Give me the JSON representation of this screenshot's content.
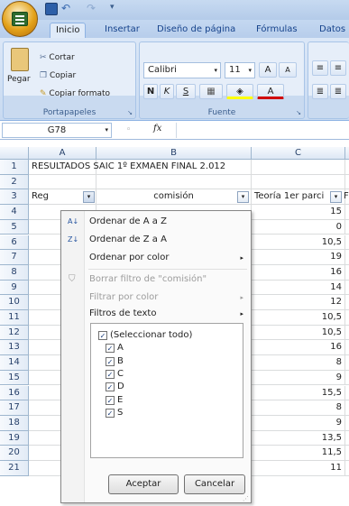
{
  "ribbon": {
    "tabs": [
      "Inicio",
      "Insertar",
      "Diseño de página",
      "Fórmulas",
      "Datos"
    ],
    "clipboard": {
      "paste": "Pegar",
      "cut": "Cortar",
      "copy": "Copiar",
      "format_painter": "Copiar formato",
      "label": "Portapapeles"
    },
    "font": {
      "name": "Calibri",
      "size": "11",
      "grow": "A",
      "shrink": "A",
      "bold": "N",
      "italic": "K",
      "underline": "S",
      "label": "Fuente"
    }
  },
  "formula_bar": {
    "name_box": "G78",
    "fx": "fx"
  },
  "sheet": {
    "columns": [
      "A",
      "B",
      "C"
    ],
    "rows": [
      {
        "n": "1",
        "a": "RESULTADOS SAIC 1º EXMAEN FINAL 2.012",
        "c": ""
      },
      {
        "n": "2",
        "a": "",
        "c": ""
      },
      {
        "n": "3",
        "a": "Reg",
        "b": "comisión",
        "c": "Teoría 1er parci"
      },
      {
        "n": "4",
        "c": "15"
      },
      {
        "n": "5",
        "c": "0"
      },
      {
        "n": "6",
        "c": "10,5"
      },
      {
        "n": "7",
        "c": "19"
      },
      {
        "n": "8",
        "c": "16"
      },
      {
        "n": "9",
        "c": "14"
      },
      {
        "n": "10",
        "c": "12"
      },
      {
        "n": "11",
        "c": "10,5"
      },
      {
        "n": "12",
        "c": "10,5"
      },
      {
        "n": "13",
        "c": "16"
      },
      {
        "n": "14",
        "c": "8"
      },
      {
        "n": "15",
        "c": "9"
      },
      {
        "n": "16",
        "c": "15,5"
      },
      {
        "n": "17",
        "c": "8"
      },
      {
        "n": "18",
        "c": "9"
      },
      {
        "n": "19",
        "c": "13,5"
      },
      {
        "n": "20",
        "c": "11,5"
      },
      {
        "n": "21",
        "c": "11"
      }
    ],
    "extra_col_letter": "F"
  },
  "filter_menu": {
    "items": [
      "Ordenar de A a Z",
      "Ordenar de Z a A",
      "Ordenar por color",
      "Borrar filtro de \"comisión\"",
      "Filtrar por color",
      "Filtros de texto"
    ],
    "list": [
      "(Seleccionar todo)",
      "A",
      "B",
      "C",
      "D",
      "E",
      "S"
    ],
    "ok": "Aceptar",
    "cancel": "Cancelar"
  }
}
